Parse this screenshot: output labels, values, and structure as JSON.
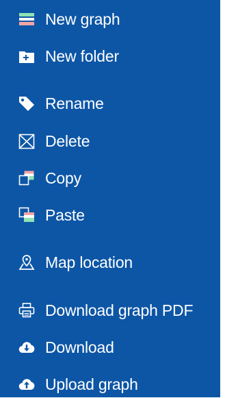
{
  "menu": {
    "items": [
      {
        "label": "New graph",
        "icon": "new-graph-icon"
      },
      {
        "label": "New folder",
        "icon": "new-folder-icon"
      },
      {
        "label": "Rename",
        "icon": "tag-icon"
      },
      {
        "label": "Delete",
        "icon": "delete-icon"
      },
      {
        "label": "Copy",
        "icon": "copy-icon"
      },
      {
        "label": "Paste",
        "icon": "paste-icon"
      },
      {
        "label": "Map location",
        "icon": "map-location-icon"
      },
      {
        "label": "Download graph PDF",
        "icon": "printer-icon"
      },
      {
        "label": "Download",
        "icon": "cloud-download-icon"
      },
      {
        "label": "Upload graph",
        "icon": "cloud-upload-icon"
      }
    ]
  },
  "colors": {
    "background": "#0d56a6",
    "text": "#ffffff",
    "accent_green": "#8fe3b3",
    "accent_pink": "#f3a4a4"
  }
}
